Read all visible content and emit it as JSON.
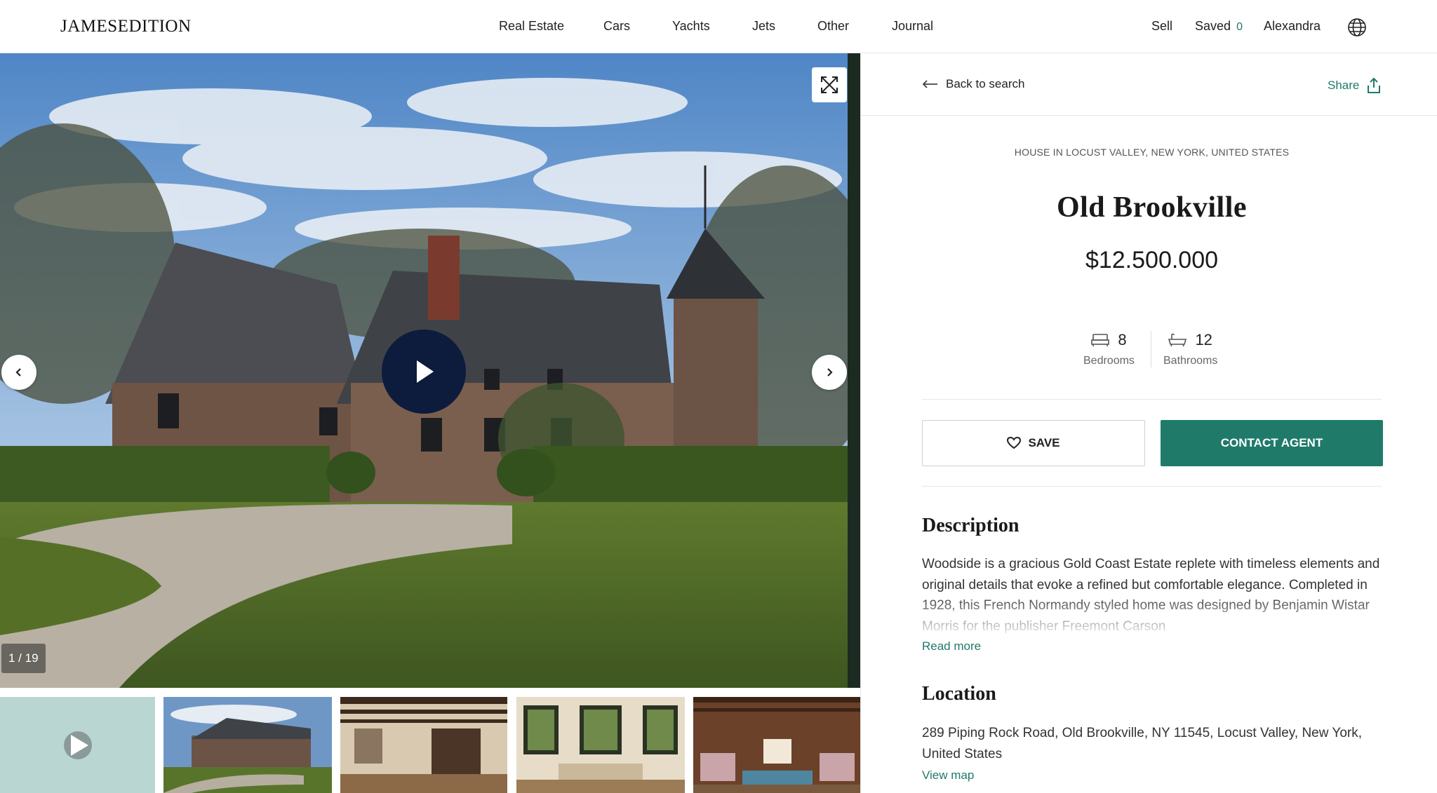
{
  "nav": {
    "logo": "JAMESEDITION",
    "links": [
      "Real Estate",
      "Cars",
      "Yachts",
      "Jets",
      "Other",
      "Journal"
    ],
    "sell": "Sell",
    "saved_label": "Saved",
    "saved_count": "0",
    "user": "Alexandra",
    "globe_icon": "globe-icon"
  },
  "gallery": {
    "counter": "1 / 19",
    "icons": {
      "fullscreen": "expand-icon",
      "prev": "chevron-left-icon",
      "next": "chevron-right-icon",
      "play": "play-icon"
    }
  },
  "listing": {
    "back_label": "Back to search",
    "share_label": "Share",
    "kicker": "HOUSE IN LOCUST VALLEY, NEW YORK, UNITED STATES",
    "title": "Old Brookville",
    "price": "$12.500.000",
    "bedrooms": {
      "value": "8",
      "label": "Bedrooms"
    },
    "bathrooms": {
      "value": "12",
      "label": "Bathrooms"
    },
    "save_label": "SAVE",
    "contact_label": "CONTACT AGENT"
  },
  "description": {
    "heading": "Description",
    "text": "Woodside is a gracious Gold Coast Estate replete with timeless elements and original details that evoke a refined but comfortable elegance. Completed in 1928, this French Normandy styled home was designed by Benjamin Wistar Morris for the publisher Freemont Carson",
    "read_more": "Read more"
  },
  "location": {
    "heading": "Location",
    "address": "289 Piping Rock Road, Old Brookville, NY 11545, Locust Valley, New York, United States",
    "view_map": "View map"
  },
  "colors": {
    "accent": "#1f7a6a",
    "play_button": "#0d1b3d"
  }
}
